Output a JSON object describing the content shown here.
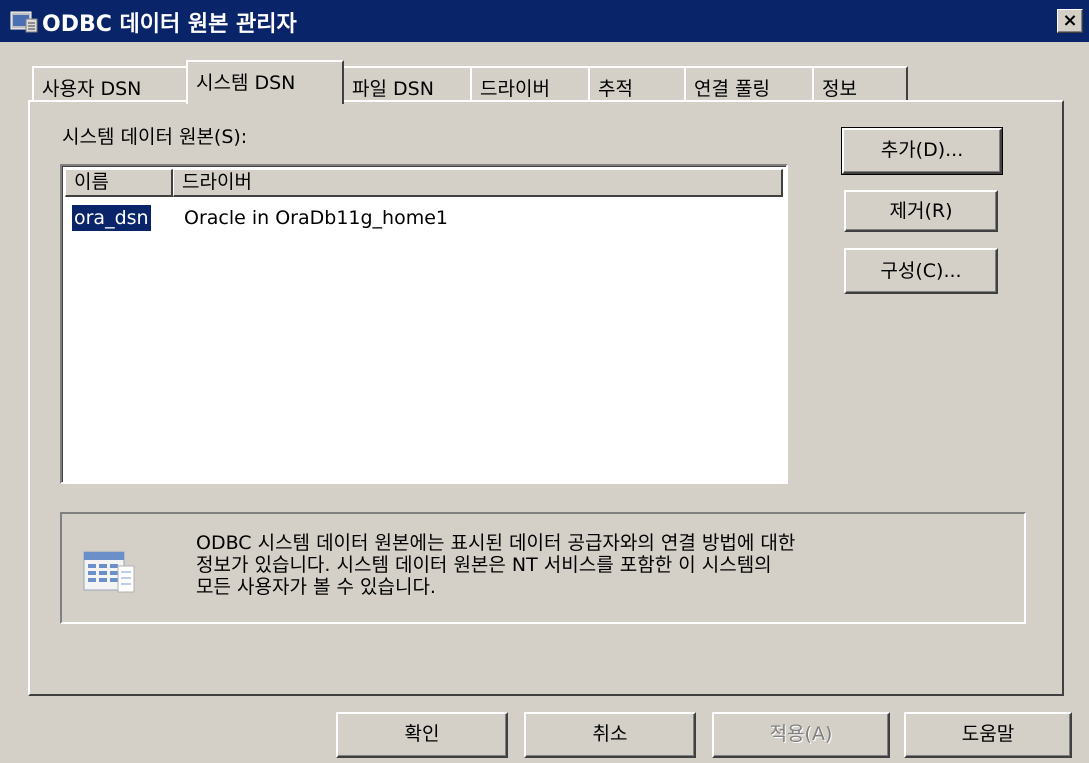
{
  "window": {
    "title": "ODBC 데이터 원본 관리자",
    "close_label": "×"
  },
  "tabs": [
    {
      "label": "사용자 DSN"
    },
    {
      "label": "시스템 DSN",
      "active": true
    },
    {
      "label": "파일 DSN"
    },
    {
      "label": "드라이버"
    },
    {
      "label": "추적"
    },
    {
      "label": "연결 풀링"
    },
    {
      "label": "정보"
    }
  ],
  "panel": {
    "sources_label": "시스템 데이터 원본(S):",
    "columns": [
      "이름",
      "드라이버"
    ],
    "rows": [
      {
        "name": "ora_dsn",
        "driver": "Oracle in OraDb11g_home1"
      }
    ],
    "buttons": {
      "add": "추가(D)...",
      "remove": "제거(R)",
      "configure": "구성(C)..."
    },
    "info_lines": [
      "ODBC 시스템 데이터 원본에는 표시된 데이터 공급자와의 연결 방법에 대한",
      "정보가 있습니다. 시스템 데이터 원본은 NT 서비스를 포함한 이 시스템의",
      "모든 사용자가 볼 수 있습니다."
    ]
  },
  "footer": {
    "ok": "확인",
    "cancel": "취소",
    "apply": "적용(A)",
    "help": "도움말"
  }
}
